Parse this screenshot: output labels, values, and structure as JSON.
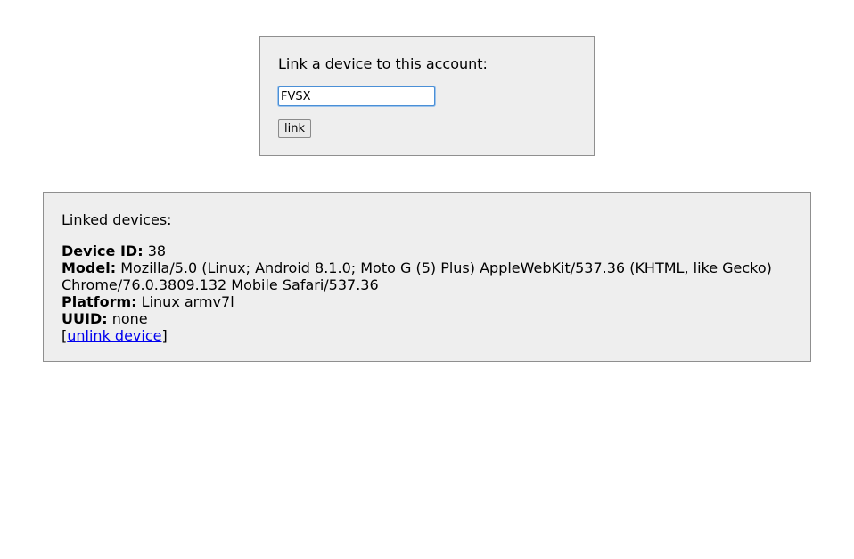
{
  "link_form": {
    "prompt": "Link a device to this account:",
    "code_value": "FVSX",
    "button_label": "link"
  },
  "devices_section": {
    "heading": "Linked devices:",
    "device": {
      "id_label": "Device ID:",
      "id_value": "38",
      "model_label": "Model:",
      "model_value": "Mozilla/5.0 (Linux; Android 8.1.0; Moto G (5) Plus) AppleWebKit/537.36 (KHTML, like Gecko) Chrome/76.0.3809.132 Mobile Safari/537.36",
      "platform_label": "Platform:",
      "platform_value": "Linux armv7l",
      "uuid_label": "UUID:",
      "uuid_value": "none",
      "unlink_open_bracket": "[",
      "unlink_label": "unlink device",
      "unlink_close_bracket": "]"
    }
  },
  "colors": {
    "panel_background": "#eeeeee",
    "panel_border": "#8f8f8f",
    "link_color": "#0000ee",
    "input_focus_border": "#4a8fd6"
  }
}
